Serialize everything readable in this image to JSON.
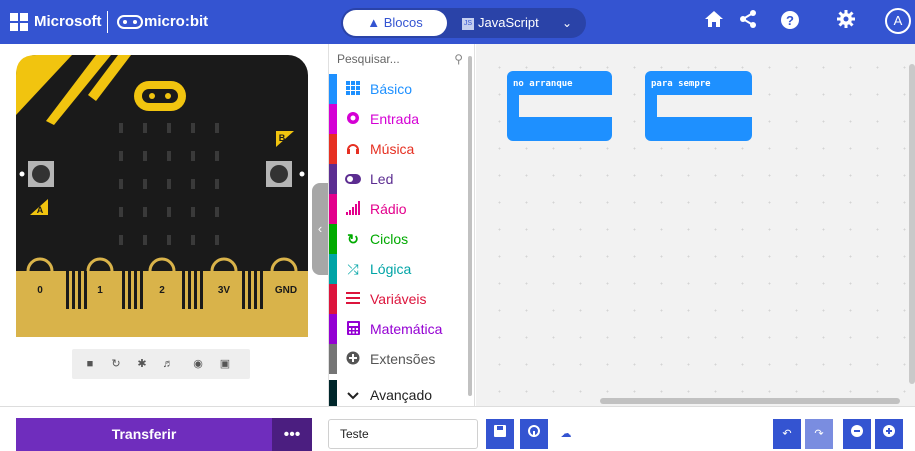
{
  "header": {
    "microsoft_label": "Microsoft",
    "microbit_label": "micro:bit",
    "tabs": [
      {
        "label": "Blocos",
        "active": true
      },
      {
        "label": "JavaScript",
        "active": false
      }
    ],
    "icons": [
      "home-icon",
      "share-icon",
      "help-icon",
      "settings-icon"
    ],
    "avatar_letter": "A",
    "accent": "#3454d1"
  },
  "simulator": {
    "pin_labels": [
      "0",
      "1",
      "2",
      "3V",
      "GND"
    ],
    "button_a": "A",
    "button_b": "B",
    "controls": [
      "stop-icon",
      "restart-icon",
      "debug-icon",
      "mute-icon",
      "screenshot-icon",
      "fullscreen-icon"
    ]
  },
  "toolbox": {
    "search_placeholder": "Pesquisar...",
    "categories": [
      {
        "label": "Básico",
        "color": "#1e90ff",
        "icon": "grid-icon"
      },
      {
        "label": "Entrada",
        "color": "#d400d4",
        "icon": "input-icon"
      },
      {
        "label": "Música",
        "color": "#e63022",
        "icon": "headphones-icon"
      },
      {
        "label": "Led",
        "color": "#5c2d91",
        "icon": "toggle-icon"
      },
      {
        "label": "Rádio",
        "color": "#e3008c",
        "icon": "signal-icon"
      },
      {
        "label": "Ciclos",
        "color": "#00aa00",
        "icon": "loop-icon"
      },
      {
        "label": "Lógica",
        "color": "#00a4a6",
        "icon": "shuffle-icon"
      },
      {
        "label": "Variáveis",
        "color": "#dc143c",
        "icon": "list-icon"
      },
      {
        "label": "Matemática",
        "color": "#9400d3",
        "icon": "calculator-icon"
      },
      {
        "label": "Extensões",
        "color": "#757575",
        "icon": "plus-circle-icon"
      },
      {
        "label": "Avançado",
        "color": "#00272b",
        "icon": "chevron-down-icon"
      }
    ]
  },
  "workspace": {
    "blocks": [
      {
        "label": "no arranque",
        "color": "#1e90ff"
      },
      {
        "label": "para sempre",
        "color": "#1e90ff"
      }
    ]
  },
  "footer": {
    "transfer_label": "Transferir",
    "more_label": "•••",
    "project_name": "Teste",
    "transfer_color": "#6f2dbd"
  }
}
